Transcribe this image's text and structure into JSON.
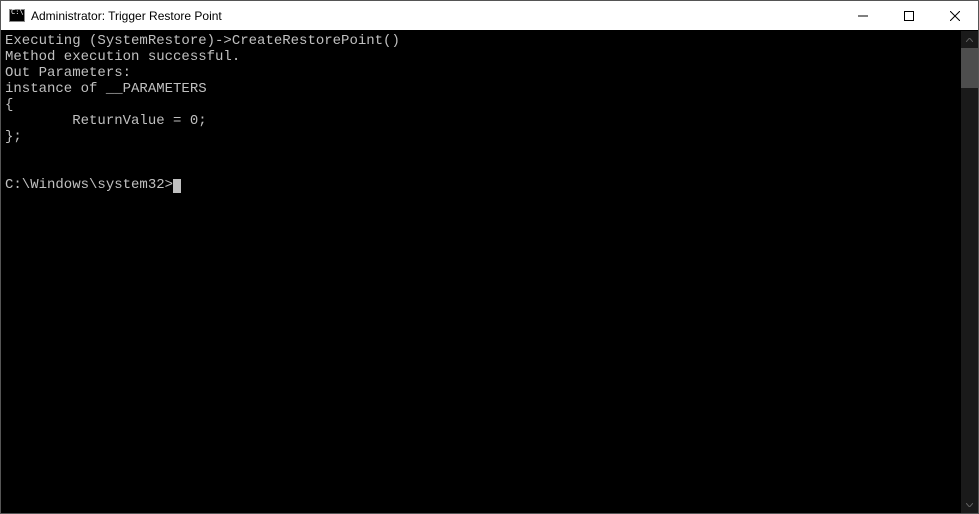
{
  "window": {
    "title": "Administrator: Trigger Restore Point"
  },
  "console": {
    "lines": [
      "Executing (SystemRestore)->CreateRestorePoint()",
      "Method execution successful.",
      "Out Parameters:",
      "instance of __PARAMETERS",
      "{",
      "        ReturnValue = 0;",
      "};",
      "",
      ""
    ],
    "prompt": "C:\\Windows\\system32>"
  }
}
